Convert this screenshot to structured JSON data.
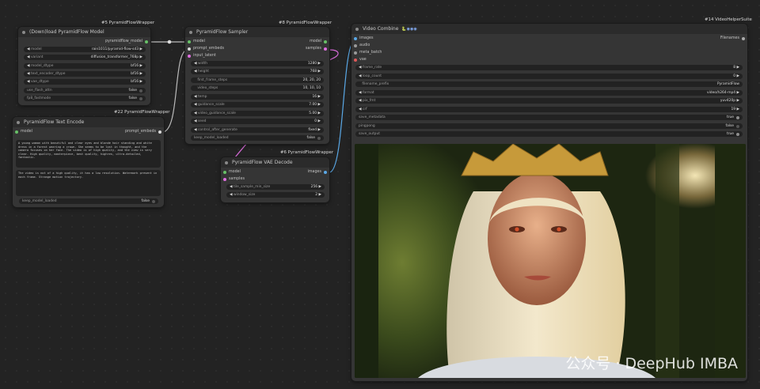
{
  "node_tags": {
    "n5": "#5 PyramidFlowWrapper",
    "n8": "#8 PyramidFlowWrapper",
    "n14": "#14 VideoHelperSuite",
    "n22": "#22 PyramidFlowWrapper",
    "n6": "#6 PyramidFlowWrapper"
  },
  "download_model": {
    "title": "(Down)load PyramidFlow Model",
    "output": "pyramidflow_model",
    "widgets": [
      {
        "label": "model",
        "value": "rain1011/pyramid-flow-sd3"
      },
      {
        "label": "variant",
        "value": "diffusion_transformer_768p"
      },
      {
        "label": "model_dtype",
        "value": "bf16"
      },
      {
        "label": "text_encoder_dtype",
        "value": "bf16"
      },
      {
        "label": "vae_dtype",
        "value": "bf16"
      }
    ],
    "toggles": [
      {
        "label": "use_flash_attn",
        "value": "false"
      },
      {
        "label": "fp8_fastmode",
        "value": "false"
      }
    ]
  },
  "text_encode": {
    "title": "PyramidFlow Text Encode",
    "input": "model",
    "output": "prompt_embeds",
    "positive": "A young woman with beautiful and clear eyes and blonde hair standing and white dress in a forest wearing a crown. She seems to be lost in thought, and the camera focuses on her face. The video is of high quality, and the view is very clear. High quality, masterpiece, best quality, highres, ultra-detailed, fantastic.",
    "negative": "The video is not of a high quality, it has a low resolution. Watermark present in each frame. Strange motion trajectory.",
    "toggle": {
      "label": "keep_model_loaded",
      "value": "false"
    }
  },
  "sampler": {
    "title": "PyramidFlow Sampler",
    "inputs": [
      "model",
      "prompt_embeds",
      "input_latent"
    ],
    "outputs": [
      "model",
      "samples"
    ],
    "widgets": [
      {
        "label": "width",
        "value": "1280"
      },
      {
        "label": "height",
        "value": "768"
      },
      {
        "label": "first_frame_steps",
        "value": "20, 20, 20"
      },
      {
        "label": "video_steps",
        "value": "10, 10, 10"
      },
      {
        "label": "temp",
        "value": "16"
      },
      {
        "label": "guidance_scale",
        "value": "7.00"
      },
      {
        "label": "video_guidance_scale",
        "value": "5.00"
      },
      {
        "label": "seed",
        "value": "0"
      },
      {
        "label": "control_after_generate",
        "value": "fixed"
      }
    ],
    "toggle": {
      "label": "keep_model_loaded",
      "value": "false"
    }
  },
  "vae_decode": {
    "title": "PyramidFlow VAE Decode",
    "inputs": [
      "model",
      "samples"
    ],
    "output": "images",
    "widgets": [
      {
        "label": "tile_sample_min_size",
        "value": "256"
      },
      {
        "label": "window_size",
        "value": "2"
      }
    ]
  },
  "video_combine": {
    "title": "Video Combine",
    "inputs": [
      "images",
      "audio",
      "meta_batch",
      "vae"
    ],
    "output": "Filenames",
    "widgets": [
      {
        "label": "frame_rate",
        "value": "8"
      },
      {
        "label": "loop_count",
        "value": "0"
      },
      {
        "label": "filename_prefix",
        "value": "PyramidFlow"
      },
      {
        "label": "format",
        "value": "video/h264-mp4"
      },
      {
        "label": "pix_fmt",
        "value": "yuv420p"
      },
      {
        "label": "crf",
        "value": "19"
      }
    ],
    "toggles": [
      {
        "label": "save_metadata",
        "value": "true"
      },
      {
        "label": "pingpong",
        "value": "false"
      },
      {
        "label": "save_output",
        "value": "true"
      }
    ]
  },
  "watermark": "公众号 · DeepHub IMBA"
}
